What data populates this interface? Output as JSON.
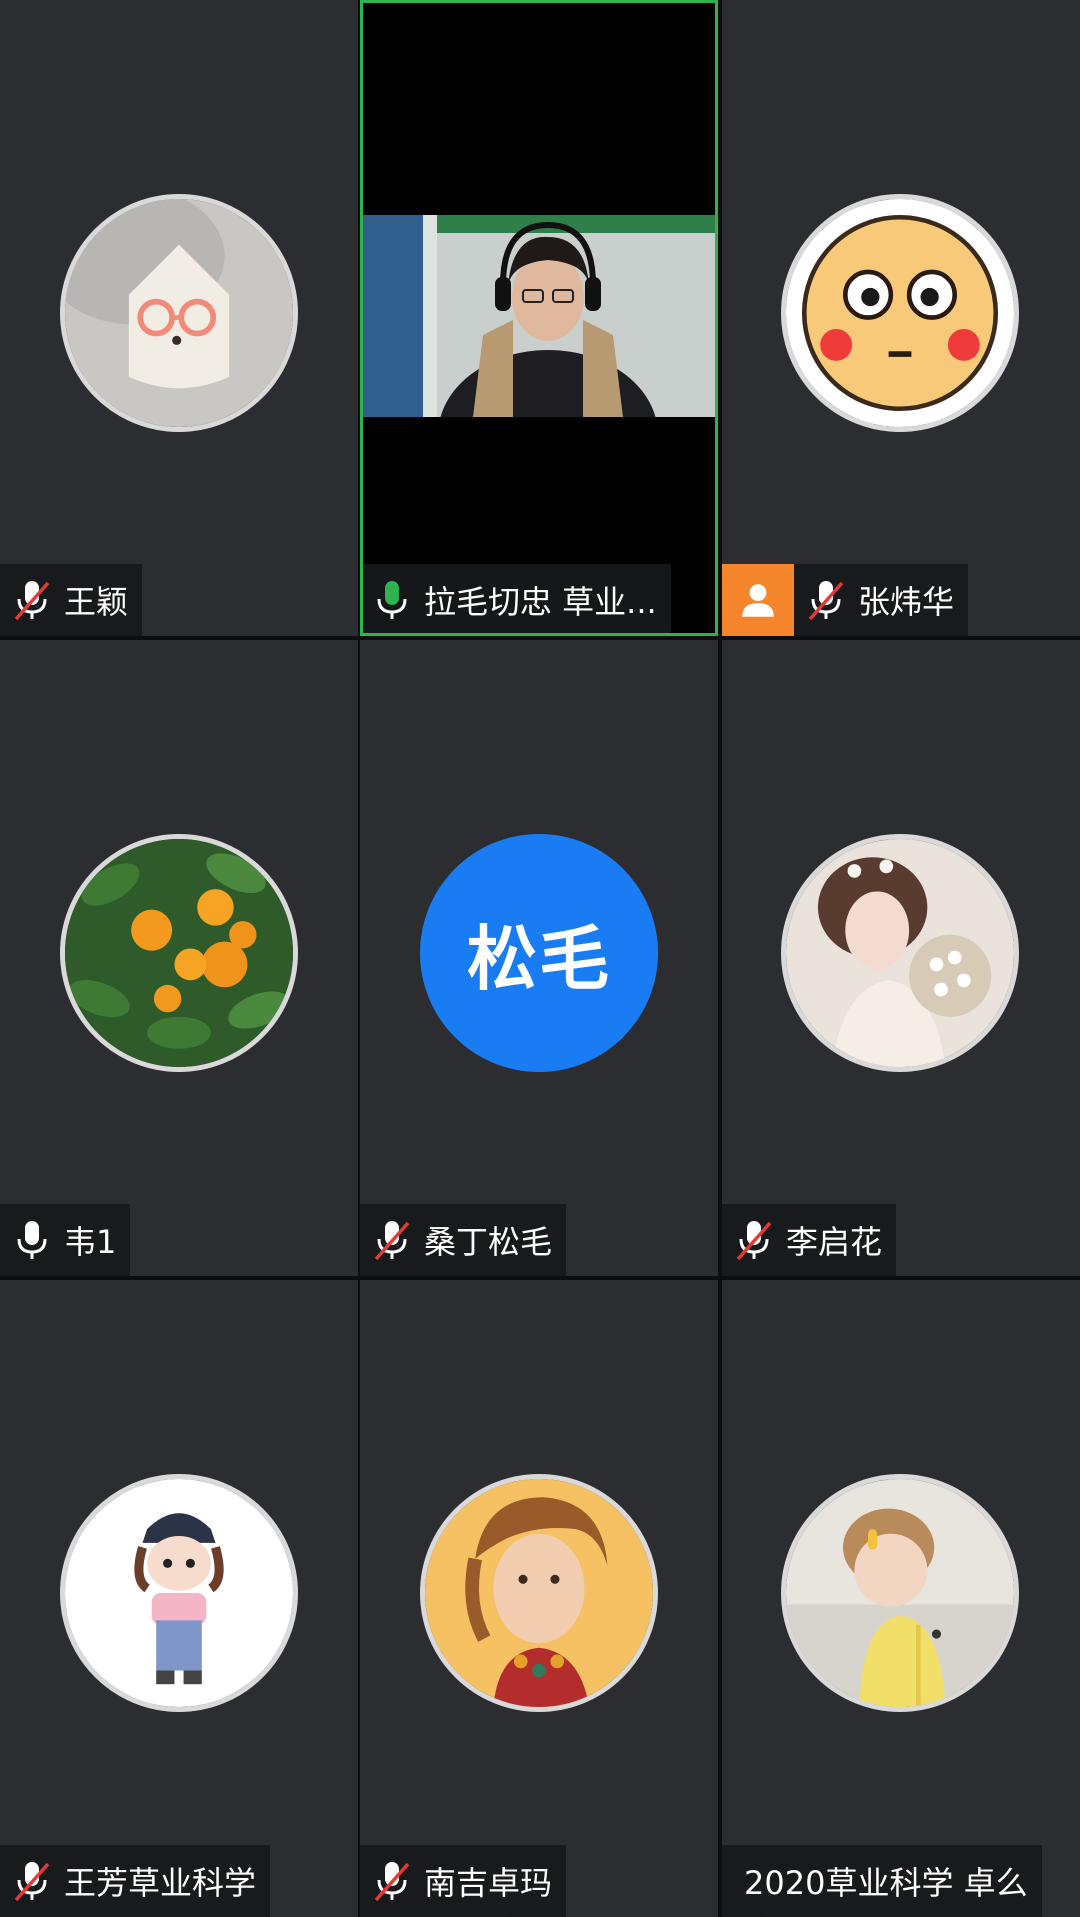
{
  "participants": [
    {
      "name": "王颖",
      "mic": "muted",
      "avatar": "pillow-with-glasses"
    },
    {
      "name": "拉毛切忠 草业...",
      "mic": "active",
      "avatar": "video-woman-headset",
      "speaking": true
    },
    {
      "name": "张炜华",
      "mic": "muted",
      "avatar": "blushing-face-emoji",
      "host": true
    },
    {
      "name": "韦1",
      "mic": "unmuted",
      "avatar": "orange-tree"
    },
    {
      "name": "桑丁松毛",
      "mic": "muted",
      "avatar_text": "松毛",
      "avatar_color": "#1a7cf2"
    },
    {
      "name": "李启花",
      "mic": "muted",
      "avatar": "woman-with-flowers"
    },
    {
      "name": "王芳草业科学",
      "mic": "muted",
      "avatar": "cartoon-girl-cap"
    },
    {
      "name": "南吉卓玛",
      "mic": "muted",
      "avatar": "painted-portrait"
    },
    {
      "name": "2020草业科学 卓么",
      "mic": "none",
      "avatar": "toddler-photo"
    }
  ],
  "colors": {
    "tile_bg": "#2c2d31",
    "active_border": "#2fb34f",
    "mic_active": "#2fb34f",
    "mic_muted_slash": "#e53935",
    "host_badge": "#f5862b"
  }
}
